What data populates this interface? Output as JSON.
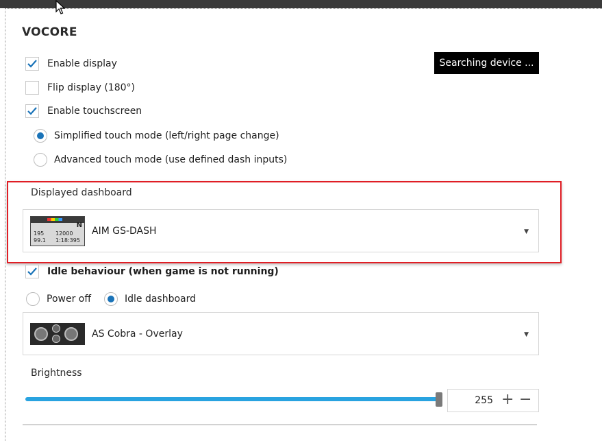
{
  "section_title": "VOCORE",
  "checkboxes": {
    "enable_display": {
      "label": "Enable display",
      "checked": true
    },
    "flip_display": {
      "label": "Flip display (180°)",
      "checked": false
    },
    "enable_touchscreen": {
      "label": "Enable touchscreen",
      "checked": true
    }
  },
  "touch_modes": [
    {
      "label": "Simplified touch mode (left/right page change)",
      "selected": true
    },
    {
      "label": "Advanced touch mode (use defined dash inputs)",
      "selected": false
    }
  ],
  "status_button": {
    "label": "Searching device ..."
  },
  "displayed_dashboard": {
    "label": "Displayed dashboard",
    "selected": "AIM GS-DASH",
    "thumb_text": {
      "speed": "195",
      "rpm": "12000",
      "gear": "N",
      "lap": "99.1",
      "time": "1:18:395"
    }
  },
  "idle_behaviour": {
    "label": "Idle behaviour (when game is not running)",
    "checked": true
  },
  "idle_options": [
    {
      "label": "Power off",
      "selected": false
    },
    {
      "label": "Idle dashboard",
      "selected": true
    }
  ],
  "idle_dashboard": {
    "selected": "AS Cobra - Overlay"
  },
  "brightness": {
    "label": "Brightness",
    "value": "255",
    "level": 1.0
  },
  "colors": {
    "accent": "#1a73b8",
    "highlight": "#e01e25",
    "slider": "#29a3e0"
  }
}
